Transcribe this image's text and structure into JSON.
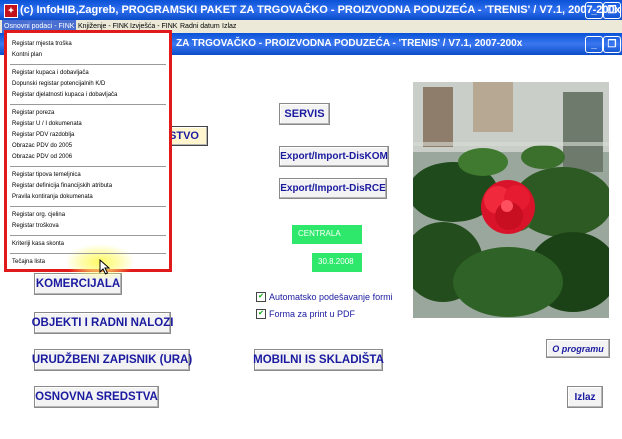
{
  "outer_window": {
    "title": "(c) InfoHIB,Zagreb, PROGRAMSKI PAKET ZA TRGOVAČKO - PROIZVODNA PODUZEĆA - 'TRENIS' / V7.1, 2007-200x",
    "minimize": "_",
    "restore": "❐"
  },
  "menubar": {
    "items": [
      "Osnovni podaci - FINK",
      "Knjiženje - FINK",
      "Izvješća - FINK",
      "Radni datum",
      "Izlaz"
    ]
  },
  "inner_window": {
    "title": "ZA TRGOVAČKO - PROIZVODNA PODUZEĆA - 'TRENIS' / V7.1, 2007-200x",
    "minimize": "_",
    "restore": "❐"
  },
  "dropdown": {
    "group1": [
      "Registar mjesta troška",
      "Kontni plan"
    ],
    "group2": [
      "Registar kupaca i dobavljača",
      "Dopunski registar potencijalnih K/D",
      "Registar djelatnosti kupaca i dobavljača"
    ],
    "group3": [
      "Registar poreza",
      "Registar U / I dokumenata",
      "Registar PDV razdoblja",
      "Obrazac PDV do 2005",
      "Obrazac PDV od 2006"
    ],
    "group4": [
      "Registar tipova temeljnica",
      "Registar definicija financijskih atributa",
      "Pravila kontiranja dokumenata"
    ],
    "group5": [
      "Registar org. cjelina",
      "Registar troškova"
    ],
    "group6": [
      "Kriteriji kasa skonta"
    ],
    "group7": [
      "Tečajna lista"
    ]
  },
  "buttons": {
    "partial_left": "STVO",
    "servis": "SERVIS",
    "export_diskom": "Export/Import-DisKOM",
    "export_disrce": "Export/Import-DisRCE",
    "komercijala": "KOMERCIJALA",
    "objekti": "OBJEKTI I RADNI NALOZI",
    "urudzbeni": "URUDŽBENI ZAPISNIK (URA)",
    "mobilni": "MOBILNI IS SKLADIŠTA",
    "osnovna": "OSNOVNA SREDSTVA",
    "o_programu": "O programu",
    "izlaz": "Izlaz"
  },
  "status": {
    "location": "CENTRALA",
    "date": "30.8.2008"
  },
  "checkboxes": [
    {
      "label": "Automatsko podešavanje formi",
      "checked": true
    },
    {
      "label": "Forma za print u PDF",
      "checked": true
    }
  ],
  "colors": {
    "titlebar": "#0a52d6",
    "menu_border": "#e01a1a",
    "status_green": "#2de86a",
    "button_text": "#1a1aa0"
  }
}
